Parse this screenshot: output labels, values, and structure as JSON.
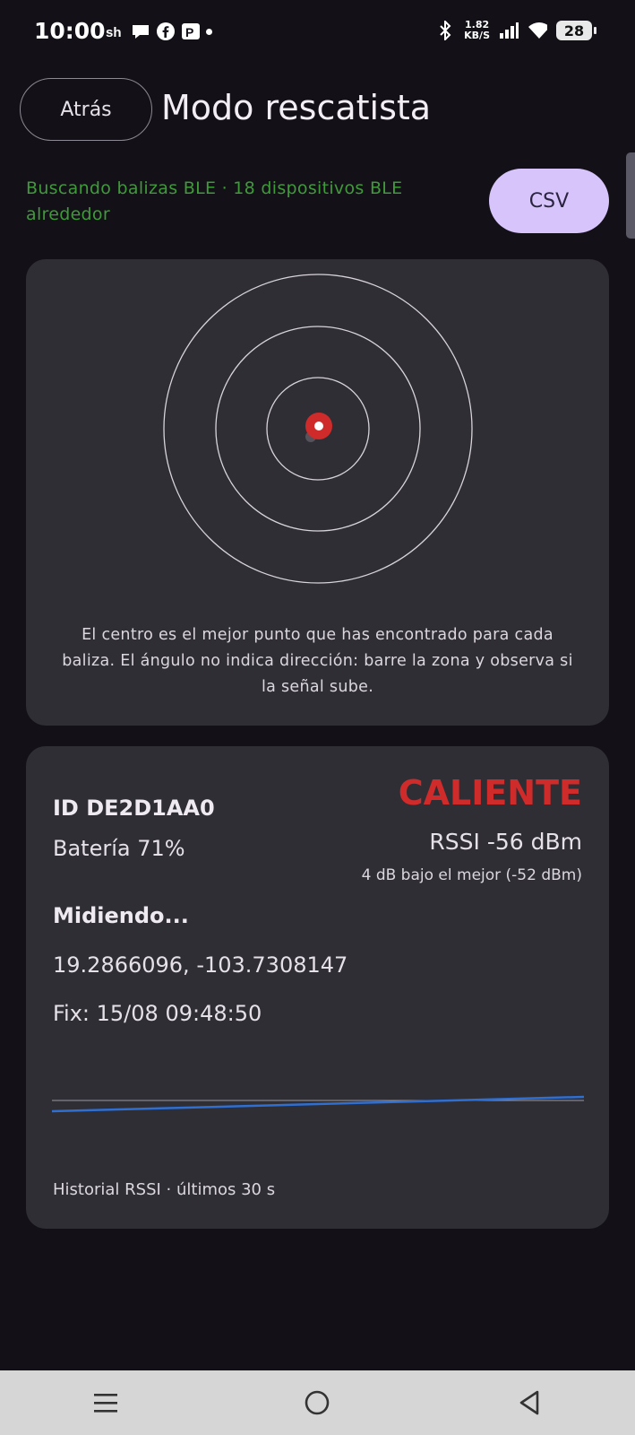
{
  "status_bar": {
    "time": "10:00",
    "net_speed_value": "1.82",
    "net_speed_unit": "KB/S",
    "battery_level": "28",
    "icons_left": [
      "sh-app-icon",
      "chat-icon",
      "facebook-icon",
      "parking-app-icon",
      "notification-dot-icon"
    ],
    "icons_right": [
      "bluetooth-icon",
      "signal-icon",
      "wifi-icon",
      "battery-icon"
    ]
  },
  "header": {
    "back_label": "Atrás",
    "title": "Modo rescatista"
  },
  "scan": {
    "status": "Buscando balizas BLE · 18 dispositivos BLE alrededor",
    "csv_label": "CSV",
    "status_color": "#3f9a3a"
  },
  "radar": {
    "caption": "El centro es el mejor punto que has encontrado para cada baliza. El ángulo no indica dirección: barre la zona y observa si la señal sube.",
    "ring_count": 3,
    "beacon_color": "#cf2b2b"
  },
  "beacon": {
    "id": "ID DE2D1AA0",
    "battery": "Batería 71%",
    "proximity_label": "CALIENTE",
    "proximity_color": "#cf2b2b",
    "rssi": "RSSI -56 dBm",
    "rssi_vs_best": "4 dB bajo el mejor (-52 dBm)",
    "measuring": "Midiendo...",
    "coordinates": "19.2866096, -103.7308147",
    "fix": "Fix: 15/08 09:48:50"
  },
  "history": {
    "label": "Historial RSSI · últimos 30 s",
    "line_color": "#2f6fd1",
    "rssi_start": -58,
    "rssi_end": -54,
    "reference": -56
  },
  "navbar": {
    "buttons": [
      "menu-icon",
      "home-icon",
      "back-icon"
    ]
  }
}
